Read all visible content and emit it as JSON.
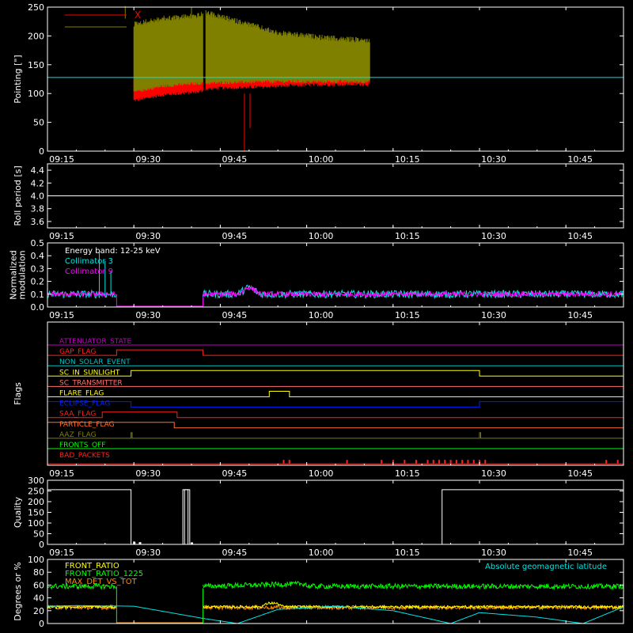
{
  "colors": {
    "background": "#000000",
    "axis": "#ffffff",
    "x_pointing": "#ff0000",
    "y_pointing": "#808000",
    "collimator3": "#00e5e5",
    "collimator9": "#ff00ff",
    "front_ratio": "#ffff00",
    "front_ratio_1225": "#00ff00",
    "max_det_vs_tot": "#ff8c00",
    "geomagnetic": "#00e5e5"
  },
  "chart_data": [
    {
      "id": "pointing",
      "type": "line",
      "ylabel": "Pointing [\"]",
      "ylim": [
        0,
        250
      ],
      "yticks": [
        0,
        50,
        100,
        150,
        200,
        250
      ],
      "xlim_minutes": [
        555,
        655
      ],
      "xtick_labels": [
        "09:15",
        "09:30",
        "09:45",
        "10:00",
        "10:15",
        "10:30",
        "10:45"
      ],
      "legend": [
        "X",
        "Y"
      ],
      "reference_line": 128,
      "series": [
        {
          "name": "X",
          "color": "#ff0000",
          "segments": [
            {
              "t": [
                570,
                575,
                581,
                582
              ],
              "low": [
                85,
                95,
                100,
                102
              ],
              "high": [
                130,
                133,
                135,
                135
              ]
            },
            {
              "t": [
                582.5,
                585,
                590,
                595,
                600,
                605,
                611
              ],
              "low": [
                105,
                107,
                108,
                110,
                112,
                113,
                113
              ],
              "high": [
                135,
                136,
                137,
                138,
                140,
                140,
                140
              ]
            }
          ],
          "dip": {
            "t": 589.2,
            "value": 0
          }
        },
        {
          "name": "Y",
          "color": "#808000",
          "segments": [
            {
              "t": [
                570,
                575,
                581,
                582
              ],
              "low": [
                100,
                110,
                115,
                115
              ],
              "high": [
                225,
                235,
                240,
                242
              ]
            },
            {
              "t": [
                582.5,
                585,
                590,
                595,
                600,
                605,
                611
              ],
              "low": [
                115,
                116,
                117,
                118,
                118,
                118,
                118
              ],
              "high": [
                245,
                238,
                225,
                210,
                205,
                200,
                197
              ]
            }
          ]
        }
      ]
    },
    {
      "id": "roll",
      "type": "line",
      "ylabel": "Roll period [s]",
      "ylim": [
        3.5,
        4.5
      ],
      "yticks": [
        3.6,
        3.8,
        4.0,
        4.2,
        4.4
      ],
      "xtick_labels": [
        "09:15",
        "09:30",
        "09:45",
        "10:00",
        "10:15",
        "10:30",
        "10:45"
      ],
      "series": [
        {
          "name": "Roll period",
          "t": [
            555,
            655
          ],
          "values": [
            4.0,
            4.0
          ]
        }
      ]
    },
    {
      "id": "modulation",
      "type": "line",
      "ylabel": [
        "Normalized",
        "modulation"
      ],
      "ylim": [
        0,
        0.5
      ],
      "yticks": [
        0.0,
        0.1,
        0.2,
        0.3,
        0.4,
        0.5
      ],
      "xtick_labels": [
        "09:15",
        "09:30",
        "09:45",
        "10:00",
        "10:15",
        "10:30",
        "10:45"
      ],
      "annotation": "Energy band: 12-25 keV",
      "legend": [
        "Collimator 3",
        "Collimator 9"
      ],
      "gap": [
        567,
        582
      ],
      "series": [
        {
          "name": "Collimator 3",
          "color": "#00e5e5",
          "base": 0.1,
          "noise": 0.03
        },
        {
          "name": "Collimator 9",
          "color": "#ff00ff",
          "base": 0.1,
          "noise": 0.02
        }
      ],
      "bump": {
        "t": [
          588,
          592
        ],
        "peak": 0.17
      },
      "spikes_c3": [
        {
          "t": 564,
          "v": 0.43
        },
        {
          "t": 565,
          "v": 0.36
        },
        {
          "t": 566,
          "v": 0.28
        }
      ]
    },
    {
      "id": "flags",
      "type": "table",
      "ylabel": "Flags",
      "xtick_labels": [
        "09:15",
        "09:30",
        "09:45",
        "10:00",
        "10:15",
        "10:30",
        "10:45"
      ],
      "flags": [
        {
          "name": "ATTENUATOR_STATE",
          "color": "#c000c0",
          "on": []
        },
        {
          "name": "GAP_FLAG",
          "color": "#ff2020",
          "on": [
            [
              567,
              582
            ]
          ]
        },
        {
          "name": "NON_SOLAR_EVENT",
          "color": "#00c0c0",
          "on": []
        },
        {
          "name": "SC_IN_SUNLIGHT",
          "color": "#ffff00",
          "on": [
            [
              569.5,
              630
            ]
          ]
        },
        {
          "name": "SC_TRANSMITTER",
          "color": "#ff7070",
          "on": []
        },
        {
          "name": "FLARE_FLAG",
          "color": "#ffff00",
          "on": [
            [
              593.5,
              597
            ]
          ]
        },
        {
          "name": "ECLIPSE_FLAG",
          "color": "#0020ff",
          "on": [
            [
              555,
              569.5
            ],
            [
              630,
              655
            ]
          ]
        },
        {
          "name": "SAA_FLAG",
          "color": "#ff2020",
          "on": [
            [
              564.5,
              577.5
            ]
          ]
        },
        {
          "name": "PARTICLE_FLAG",
          "color": "#ff7030",
          "on": [
            [
              555,
              577
            ]
          ]
        },
        {
          "name": "AAZ_FLAG",
          "color": "#808000",
          "on": [
            [
              569.5,
              569.7
            ],
            [
              630,
              630.2
            ]
          ]
        },
        {
          "name": "FRONTS_OFF",
          "color": "#00ff00",
          "on": []
        },
        {
          "name": "BAD_PACKETS",
          "color": "#ff2020",
          "ticks": [
            596,
            597,
            607,
            613,
            615,
            617,
            619,
            621,
            622,
            623,
            624,
            625,
            626,
            627,
            628,
            629,
            630,
            631,
            652,
            654
          ]
        }
      ]
    },
    {
      "id": "quality",
      "type": "line",
      "ylabel": "Quality",
      "ylim": [
        0,
        300
      ],
      "yticks": [
        0,
        50,
        100,
        150,
        200,
        250,
        300
      ],
      "xtick_labels": [
        "09:15",
        "09:30",
        "09:45",
        "10:00",
        "10:15",
        "10:30",
        "10:45"
      ],
      "series": [
        {
          "name": "Quality",
          "color": "#ffffff",
          "t": [
            555,
            569.5,
            569.5,
            578.5,
            578.5,
            579.7,
            579.7,
            582.3,
            582.3,
            623.5,
            623.5,
            655
          ],
          "values": [
            256,
            256,
            0,
            0,
            256,
            256,
            0,
            0,
            0,
            0,
            256,
            256
          ]
        }
      ]
    },
    {
      "id": "ratios",
      "type": "line",
      "ylabel": "Degrees or %",
      "ylim": [
        0,
        100
      ],
      "yticks": [
        0,
        20,
        40,
        60,
        80,
        100
      ],
      "xtick_labels": [
        "09:15",
        "09:30",
        "09:45",
        "10:00",
        "10:15",
        "10:30",
        "10:45"
      ],
      "legend": [
        "FRONT_RATIO",
        "FRONT_RATIO_1225",
        "MAX_DET_VS_TOT"
      ],
      "right_legend": "Absolute geomagnetic latitude",
      "gap": [
        567,
        582
      ],
      "series": [
        {
          "name": "FRONT_RATIO",
          "color": "#ffff00",
          "base": 26,
          "noise": 2
        },
        {
          "name": "FRONT_RATIO_1225",
          "color": "#00ff00",
          "base_start": 58,
          "base_end": 58,
          "noise": 4
        },
        {
          "name": "MAX_DET_VS_TOT",
          "color": "#ff8c00",
          "base": 25,
          "noise": 3
        },
        {
          "name": "Absolute geomagnetic latitude",
          "color": "#00e5e5",
          "t": [
            555,
            560,
            570,
            582,
            588,
            595,
            605,
            615,
            620,
            625,
            630,
            640,
            648,
            655
          ],
          "values": [
            27,
            28,
            27,
            8,
            0,
            22,
            27,
            20,
            10,
            0,
            17,
            10,
            0,
            26
          ]
        }
      ]
    }
  ]
}
